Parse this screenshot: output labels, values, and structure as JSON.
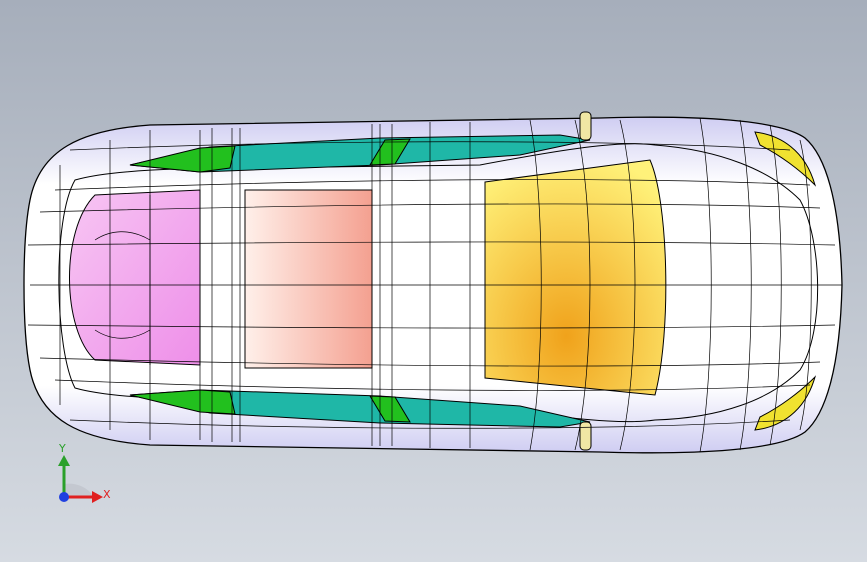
{
  "viewport": {
    "background_top": "#a6aebb",
    "background_bottom": "#d6dbe2"
  },
  "model": {
    "body_color": "#ffffff",
    "body_edge_color": "#d9d8f5",
    "wireframe_color": "#000000",
    "rear_glass_color": "#f2a6ef",
    "roof_panel_color": "#f5a899",
    "windshield_color": "#f5c72a",
    "side_glass_color": "#1fb7a7",
    "side_trim_color": "#22c01e",
    "mirror_color": "#f0e7a4",
    "headlight_color": "#f0e230"
  },
  "triad": {
    "x_label": "X",
    "y_label": "Y",
    "x_color": "#e02020",
    "y_color": "#2aa02a",
    "z_color": "#2040e0"
  }
}
